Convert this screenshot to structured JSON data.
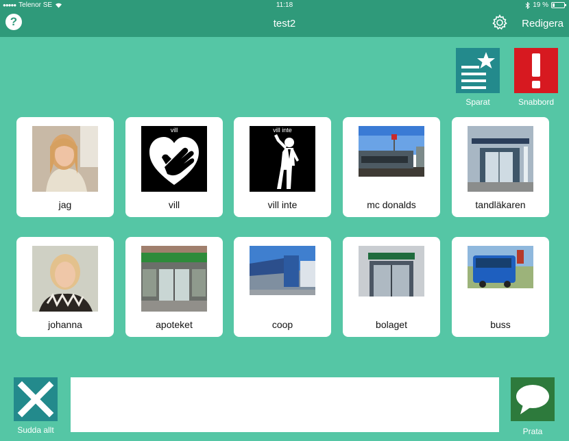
{
  "status": {
    "carrier": "Telenor SE",
    "time": "11:18",
    "battery": "19 %"
  },
  "nav": {
    "help_label": "?",
    "title": "test2",
    "edit_label": "Redigera"
  },
  "top_buttons": {
    "saved_label": "Sparat",
    "quick_label": "Snabbord"
  },
  "cards": [
    {
      "label": "jag",
      "picture_label": ""
    },
    {
      "label": "vill",
      "picture_label": "vill"
    },
    {
      "label": "vill inte",
      "picture_label": "vill inte"
    },
    {
      "label": "mc donalds",
      "picture_label": ""
    },
    {
      "label": "tandläkaren",
      "picture_label": ""
    },
    {
      "label": "johanna",
      "picture_label": ""
    },
    {
      "label": "apoteket",
      "picture_label": ""
    },
    {
      "label": "coop",
      "picture_label": ""
    },
    {
      "label": "bolaget",
      "picture_label": ""
    },
    {
      "label": "buss",
      "picture_label": ""
    }
  ],
  "bottom": {
    "clear_label": "Sudda allt",
    "speak_label": "Prata",
    "message_text": ""
  },
  "colors": {
    "background": "#55c6a5",
    "bar": "#2f9a7a",
    "saved_tile": "#238a8c",
    "quick_tile": "#d71920",
    "speak_tile": "#2d7a3c"
  }
}
